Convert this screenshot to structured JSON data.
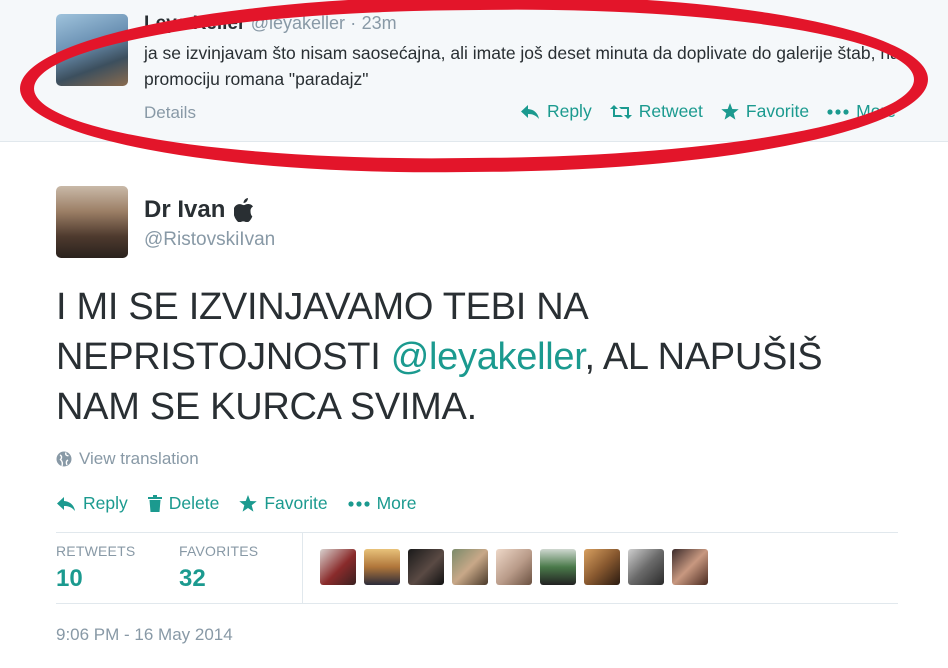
{
  "top_tweet": {
    "name": "Leya Keller",
    "handle": "@leyakeller",
    "dot": "·",
    "time": "23m",
    "text": "ja se izvinjavam što nisam saosećajna, ali imate još deset minuta da doplivate do galerije štab, na promociju romana \"paradajz\"",
    "details_label": "Details",
    "actions": [
      {
        "label": "Reply",
        "icon": "reply-icon"
      },
      {
        "label": "Retweet",
        "icon": "retweet-icon"
      },
      {
        "label": "Favorite",
        "icon": "star-icon"
      },
      {
        "label": "More",
        "icon": "more-dots-icon"
      }
    ]
  },
  "main_tweet": {
    "name": "Dr Ivan",
    "name_icon": "apple-icon",
    "handle": "@RistovskiIvan",
    "text_before": "I MI SE IZVINJAVAMO TEBI NA NEPRISTOJNOSTI ",
    "mention": "@leyakeller",
    "text_after": ", AL NAPUŠIŠ NAM SE KURCA SVIMA.",
    "view_translation": "View translation",
    "actions": [
      {
        "label": "Reply",
        "icon": "reply-icon"
      },
      {
        "label": "Delete",
        "icon": "trash-icon"
      },
      {
        "label": "Favorite",
        "icon": "star-icon"
      },
      {
        "label": "More",
        "icon": "more-dots-icon"
      }
    ],
    "stats": {
      "retweets_label": "RETWEETS",
      "retweets_value": "10",
      "favorites_label": "FAVORITES",
      "favorites_value": "32"
    },
    "timestamp": "9:06 PM - 16 May 2014"
  },
  "colors": {
    "accent": "#1b9a8f",
    "muted": "#8899a6",
    "highlight_ring": "#e3152a"
  }
}
